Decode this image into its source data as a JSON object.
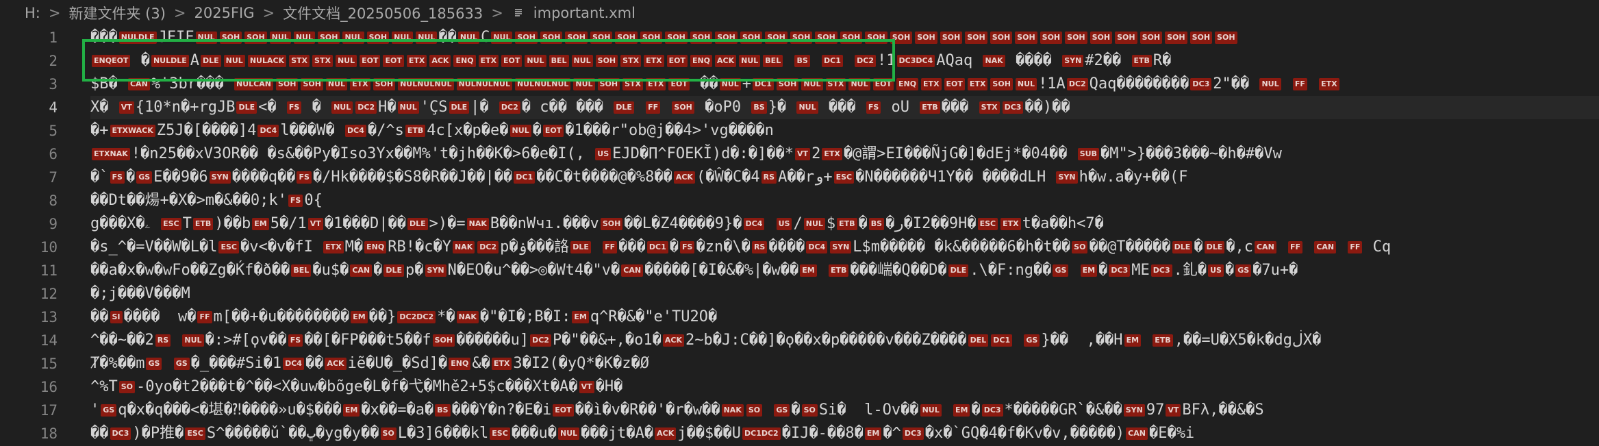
{
  "breadcrumb": {
    "items": [
      "H:",
      "新建文件夹 (3)",
      "2025FIG",
      "文件文档_20250506_185633",
      "important.xml"
    ],
    "separator": ">"
  },
  "editor": {
    "line_numbers": [
      "1",
      "2",
      "3",
      "4",
      "5",
      "6",
      "7",
      "8",
      "9",
      "10",
      "11",
      "12",
      "13",
      "14",
      "15",
      "16",
      "17",
      "18"
    ],
    "lines": [
      "���\u0000\u0010JFIF\u0000\u0001\u0001\u0000\u0000\u0001\u0000\u0001\u0000\u0000��\u0000C\u0000\u0001\u0001\u0001\u0001\u0001\u0001\u0001\u0001\u0001\u0001\u0001\u0001\u0001\u0001\u0001\u0001\u0001\u0001\u0001\u0001\u0001\u0001\u0001\u0001\u0001\u0001\u0001\u0001\u0001",
      "ENQEOT �\u0000\u0010ADLENULNULACKSTXSTXNULEOTEOTETXACKENQETXEOTNULBELNULSOHSTXETXEOTENQACKNULBEL BS DC1 DC2!1DC3DC4AQaq NAK ���� SYN#2�� ETBR�",
      "$B� CAN%'3br��� NULCANSOHSOHNULETXSOHNULNULNULNULNULNULNULNULNULNULSOHSTXETXEOT ��NUL+DC1SOHNULSTXNULEOTENQETXEOTETXSOHNUL!1ADC2Qaq��������DC32\"�� NUL FF ETX",
      "X� VT{10*n�+rgJBDLE<� FS � NULDC2H�NUL'ÇSDLE|� DC2� c�� ��� DLE FF SOH �oP0 BS}� NUL ��� FS oU ETB��� STXDC3��)��",
      "�+ETXWACKZ5J�[����]4DC4l���W� DC4�/^sETB4c[x�p�e�NUL�EOT�1���r\"ob@j��4>'vg����n",
      "ETXNAK!�n25��xV3OR�� �s&��Py�Iso3Yx��M%'t�jh��K�>6�e�I(, USEJD�Π^FOEKĬ)d�:�]��*VT2ETX�@謂>EI���ÑjG�]�dEj*�04�� SUB�M\">}���3���~�h�#�Vw",
      "�`FS�GSE��9�6SYN����q��FS�/Hk����$�S8�R��J��|��DC1��C�t����@�%8��ACK(�Ŵ�C�4RSA��rو+ESC�N������Ч1Y�� ����dԼH SYNh�w.a�y+��(F",
      "��Dt��煬+�X�>m�&��0;k'FS0{",
      "g���X�ۦ ESCTETB)��bEM5�/1VT�1���D|��DLE>)�=NAKB��nWчı.���vSOH��L�Zر�BS�ETB$NUL/US DC4�{9����4�I2��9H�ESCETXt�a��h<7�",
      "�s_^�=V��W�L�lESC�v<�v�fI ETXM�ENQRB!�c�YNAKDC2p�ۏ���詻DLE FF���DC1�FS�zn�\\�RS����DC4SYNL$m����� �k&�����6�h�t��SO��@T�����DLE�DLE�,cCAN FF CAN FF Cq",
      "��a�x�w�wFo��Zg�Ḱf�ð��BEL�u$�CAN�DLEp�SYNN�EO�u^��>◎�Wt4�\"v�CAN�����[�I�&�%|�w��EM ETB���㟨�Q��D�DLE.\\�F:ng��GS EM�DC3MEDC3.釓�US�GS�7u+�",
      "�;j���V���M",
      "��SI����  w�FFm[��+�u��������EM��}DC2DC2*�NAK�\"�I�;B�I:EMq^R�&�\"e'TU2O�",
      "^��~��2RS NUL�:>#[ϙv��FS��[�FP���t5��fSOH������u]DC2P�\"��&+,�o1�ACK2~b�J:C��]�ϙ��x�p�����v���Z����DELDC1 GS}��  ,��HEM ETB,��=U�X5�k�dgڶX�",
      "Ⱦ�%��mGS GS�_���#Si�1DC4��ACKiẽ�U�_�Sd]�ENQ&�ETX3�I2(�yQ*�K�z�Ø",
      "^%TSO-0yo�t2���t�^��<X�uw�bõge�L�f�弋�Mhě2+5$c���Xt�A�VT�H�",
      "'GSq�x�q���<�堪�⁈����»u�$���EM�x��=�a�BS���Y�n?�E�iEOT��ì�v�R��'�r�w��NAKSO GS�SOSi�  l-Ov��NUL EM�DC3*�����GR`�&��SYN97VTBFλ,��&�S",
      "��DC3)�P推�ESCS^�����ǔ`��ڀ�yg�y��SOL�3]6���klESC���u�NUL���jt�A�ACKj��$��UDC1DC2�IJ�-��8�EM�^DC3�x�`GQ�4�f�Kv�v,�����)CAN�E�%i"
    ]
  },
  "colors": {
    "background": "#1f1f1f",
    "control_char_bg": "#8b1a10",
    "highlight_border": "#22b045",
    "line_number": "#858585"
  },
  "icons": {
    "file": "file-lines-icon"
  }
}
